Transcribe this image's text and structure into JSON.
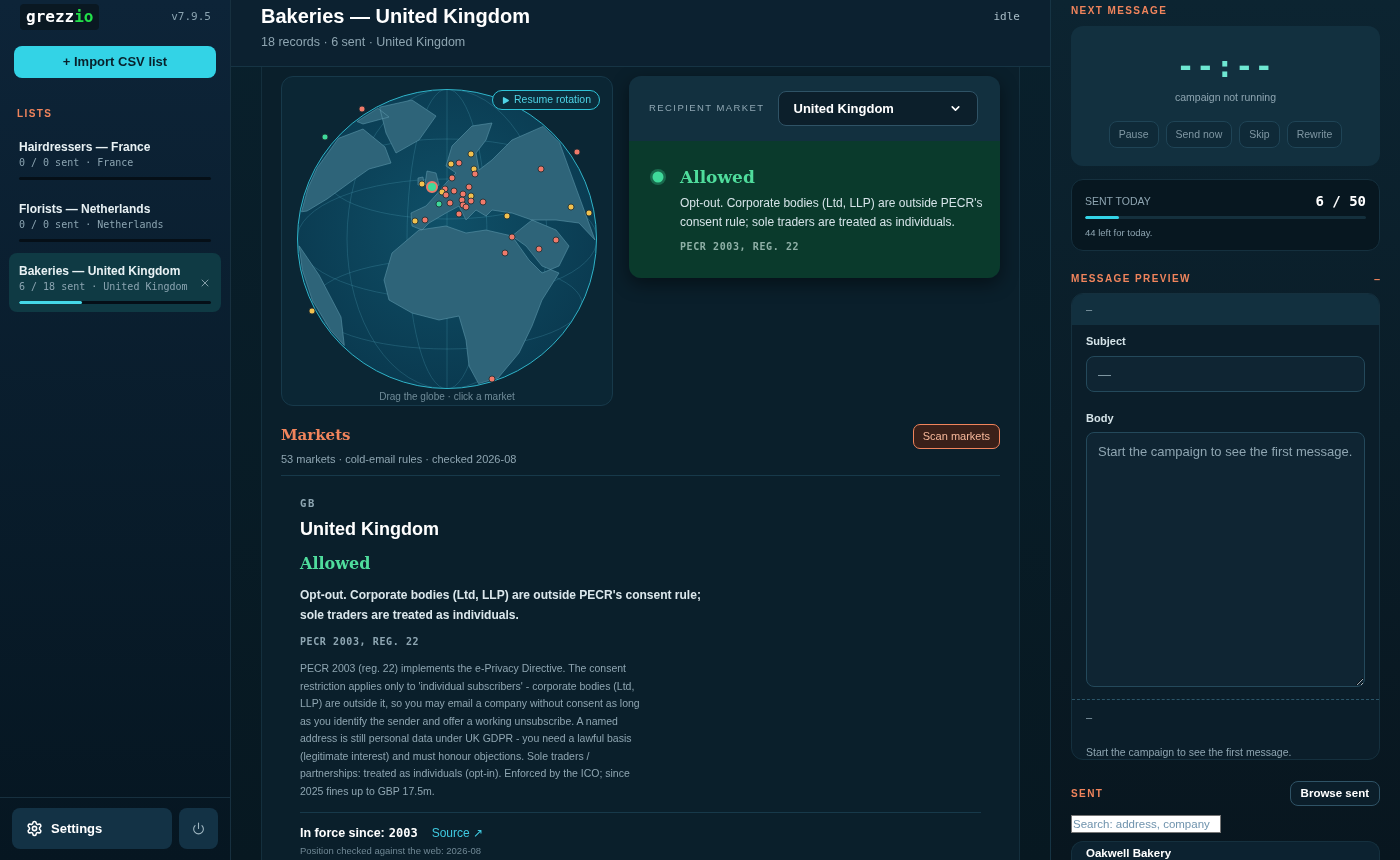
{
  "sidebar": {
    "logo": {
      "text": "grezz",
      "accent": "io"
    },
    "version": "v7.9.5",
    "import_button": "+ Import CSV list",
    "lists_heading": "LISTS",
    "lists": [
      {
        "name": "Hairdressers — France",
        "meta": "0 / 0 sent · France",
        "selected": false
      },
      {
        "name": "Florists — Netherlands",
        "meta": "0 / 0 sent · Netherlands",
        "selected": false
      },
      {
        "name": "Bakeries — United Kingdom",
        "meta": "6 / 18 sent · United Kingdom",
        "level": 0.33,
        "selected": true
      }
    ],
    "settings_button": "Settings"
  },
  "header": {
    "title": "Bakeries — United Kingdom",
    "subtitle": "18 records · 6 sent · United Kingdom",
    "status": "idle"
  },
  "globe": {
    "resume_button": "Resume rotation",
    "caption": "Drag the globe · click a market",
    "markers": [
      {
        "color": "#f07a6a",
        "selected": false
      },
      {
        "color": "#3fd99a",
        "selected": false
      },
      {
        "color": "#f2c14e",
        "selected": false
      },
      {
        "color": "#f2c14e",
        "selected": false
      },
      {
        "color": "#f07a6a",
        "selected": false
      },
      {
        "color": "#f2c14e",
        "selected": false
      },
      {
        "color": "#f07a6a",
        "selected": false
      },
      {
        "color": "#f07a6a",
        "selected": false
      },
      {
        "color": "#f2c14e",
        "selected": false
      },
      {
        "color": "#3fd99a",
        "selected": true
      },
      {
        "color": "#f07a6a",
        "selected": false
      },
      {
        "color": "#f2c14e",
        "selected": false
      },
      {
        "color": "#f07a6a",
        "selected": false
      },
      {
        "color": "#f07a6a",
        "selected": false
      },
      {
        "color": "#f07a6a",
        "selected": false
      },
      {
        "color": "#f07a6a",
        "selected": false
      },
      {
        "color": "#f2c14e",
        "selected": false
      },
      {
        "color": "#f07a6a",
        "selected": false
      },
      {
        "color": "#f07a6a",
        "selected": false
      },
      {
        "color": "#f07a6a",
        "selected": false
      },
      {
        "color": "#f07a6a",
        "selected": false
      },
      {
        "color": "#f07a6a",
        "selected": false
      },
      {
        "color": "#f07a6a",
        "selected": false
      },
      {
        "color": "#3fd99a",
        "selected": false
      },
      {
        "color": "#f07a6a",
        "selected": false
      },
      {
        "color": "#f07a6a",
        "selected": false
      },
      {
        "color": "#f2c14e",
        "selected": false
      },
      {
        "color": "#f2c14e",
        "selected": false
      },
      {
        "color": "#f07a6a",
        "selected": false
      },
      {
        "color": "#f07a6a",
        "selected": false
      },
      {
        "color": "#f2c14e",
        "selected": false
      },
      {
        "color": "#f2c14e",
        "selected": false
      },
      {
        "color": "#f07a6a",
        "selected": false
      },
      {
        "color": "#f07a6a",
        "selected": false
      },
      {
        "color": "#f07a6a",
        "selected": false
      },
      {
        "color": "#f07a6a",
        "selected": false
      },
      {
        "color": "#f2c14e",
        "selected": false
      },
      {
        "color": "#f07a6a",
        "selected": false
      }
    ]
  },
  "market_card": {
    "label": "RECIPIENT MARKET",
    "select_value": "United Kingdom",
    "kind": "allowed",
    "verdict": "Allowed",
    "summary": "Opt-out. Corporate bodies (Ltd, LLP) are outside PECR's consent rule; sole traders are treated as individuals.",
    "citation": "PECR 2003, REG. 22"
  },
  "markets": {
    "title": "Markets",
    "subtitle": "53 markets · cold-email rules · checked 2026-08",
    "scan_button": "Scan markets",
    "detail": {
      "code": "GB",
      "name": "United Kingdom",
      "kind": "allowed",
      "verdict": "Allowed",
      "summary": "Opt-out. Corporate bodies (Ltd, LLP) are outside PECR's consent rule; sole traders are treated as individuals.",
      "citation": "PECR 2003, REG. 22",
      "description": "PECR 2003 (reg. 22) implements the e-Privacy Directive. The consent restriction applies only to 'individual subscribers' - corporate bodies (Ltd, LLP) are outside it, so you may email a company without consent as long as you identify the sender and offer a working unsubscribe. A named address is still personal data under UK GDPR - you need a lawful basis (legitimate interest) and must honour objections. Sole traders / partnerships: treated as individuals (opt-in). Enforced by the ICO; since 2025 fines up to GBP 17.5m.",
      "in_force_label": "In force since:",
      "in_force_year": "2003",
      "source_link": "Source ↗",
      "checked": "Position checked against the web: 2026-08"
    }
  },
  "right_panel": {
    "next_message": {
      "heading": "NEXT MESSAGE",
      "timer": "--:--",
      "status": "campaign not running",
      "buttons": [
        {
          "label": "Pause",
          "disabled": true
        },
        {
          "label": "Send now",
          "disabled": true
        },
        {
          "label": "Skip",
          "disabled": true
        },
        {
          "label": "Rewrite",
          "disabled": true
        }
      ]
    },
    "sent_today": {
      "label": "SENT TODAY",
      "count": "6 / 50",
      "level": 0.12,
      "remaining": "44 left for today."
    },
    "message_preview": {
      "heading": "MESSAGE PREVIEW",
      "collapse": "–",
      "header": "–",
      "subject_label": "Subject",
      "subject_value": "—",
      "body_label": "Body",
      "body_placeholder": "Start the campaign to see the first message.",
      "footer_dash": "–",
      "footer_text": "Start the campaign to see the first message."
    },
    "sent": {
      "heading": "SENT",
      "browse_button": "Browse sent",
      "search_placeholder": "Search: address, company",
      "items": [
        {
          "name": "Oakwell Bakery"
        }
      ]
    }
  }
}
